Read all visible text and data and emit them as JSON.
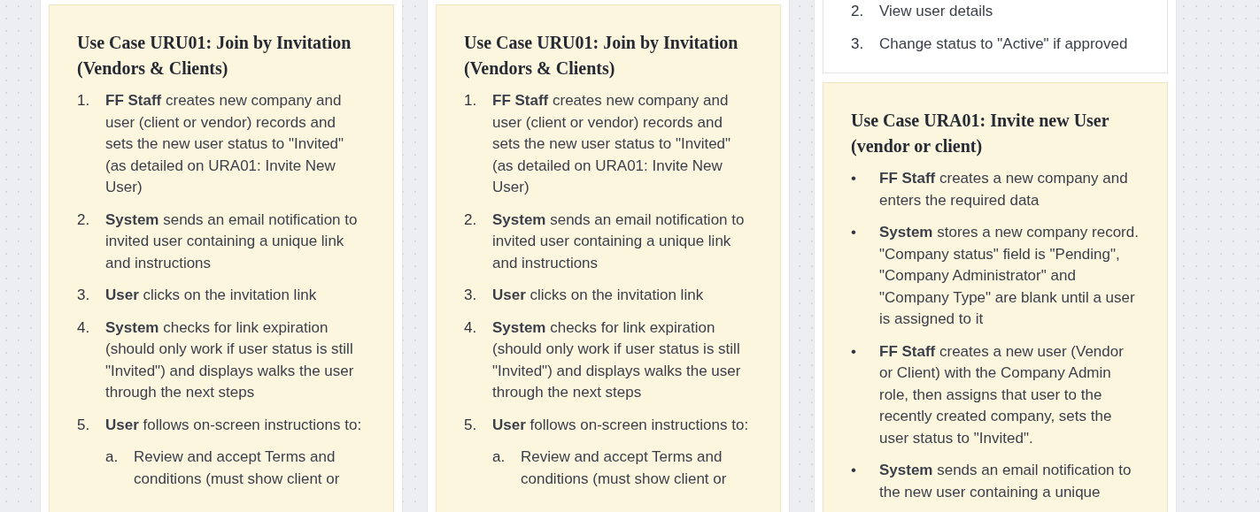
{
  "columns": [
    {
      "cards": [
        {
          "kind": "use_case",
          "title": "Use Case URU01: Join by Invitation (Vendors & Clients)",
          "items": [
            {
              "marker": "1.",
              "text": "**FF Staff** creates new company and user (client or vendor) records and sets the new user status to \"Invited\" (as detailed on URA01: Invite New User)"
            },
            {
              "marker": "2.",
              "text": "**System** sends an email notification to invited user containing a unique link and instructions"
            },
            {
              "marker": "3.",
              "text": "**User** clicks on the invitation link"
            },
            {
              "marker": "4.",
              "text": "**System** checks for link expiration (should only work if user status is still \"Invited\") and displays walks the user through the next steps"
            },
            {
              "marker": "5.",
              "text": "**User** follows on-screen instructions to:",
              "children": [
                {
                  "marker": "a.",
                  "text": "Review and accept Terms and conditions (must show client or"
                }
              ]
            }
          ]
        }
      ]
    },
    {
      "cards": [
        {
          "kind": "use_case",
          "title": "Use Case URU01: Join by Invitation (Vendors & Clients)",
          "items": [
            {
              "marker": "1.",
              "text": "**FF Staff** creates new company and user (client or vendor) records and sets the new user status to \"Invited\" (as detailed on URA01: Invite New User)"
            },
            {
              "marker": "2.",
              "text": "**System** sends an email notification to invited user containing a unique link and instructions"
            },
            {
              "marker": "3.",
              "text": "**User** clicks on the invitation link"
            },
            {
              "marker": "4.",
              "text": "**System** checks for link expiration (should only work if user status is still \"Invited\") and displays walks the user through the next steps"
            },
            {
              "marker": "5.",
              "text": "**User** follows on-screen instructions to:",
              "children": [
                {
                  "marker": "a.",
                  "text": "Review and accept Terms and conditions (must show client or"
                }
              ]
            }
          ]
        }
      ]
    },
    {
      "cards": [
        {
          "kind": "plain",
          "items": [
            {
              "marker": "2.",
              "text": "View user details"
            },
            {
              "marker": "3.",
              "text": "Change status to \"Active\" if approved"
            }
          ]
        },
        {
          "kind": "use_case",
          "title": "Use Case URA01: Invite new User (vendor or client)",
          "items": [
            {
              "marker": "•",
              "text": "**FF Staff** creates a new company and enters the required data"
            },
            {
              "marker": "•",
              "text": "**System** stores a new company record. \"Company status\" field is \"Pending\", \"Company Administrator\" and \"Company Type\" are blank until a user is assigned to it"
            },
            {
              "marker": "•",
              "text": "**FF Staff** creates a new user (Vendor or Client) with the Company Admin role, then assigns that user to the recently created company, sets the user status to \"Invited\"."
            },
            {
              "marker": "•",
              "text": "**System** sends an email notification to the new user containing a unique"
            }
          ]
        }
      ]
    }
  ]
}
